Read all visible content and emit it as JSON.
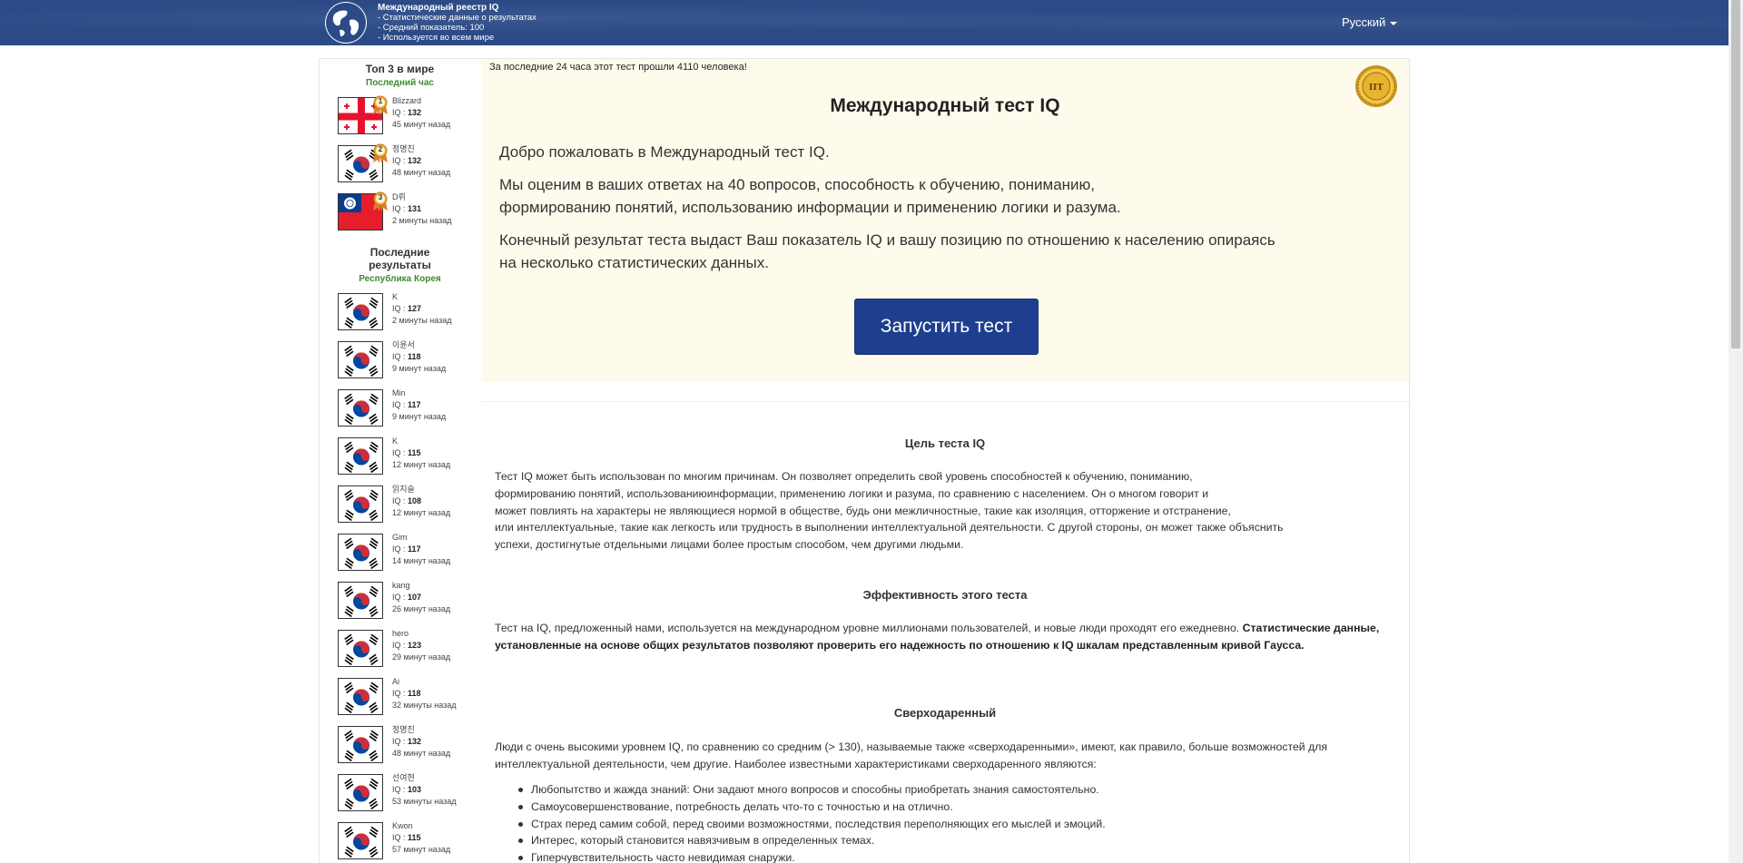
{
  "header": {
    "brand_title": "Международный реестр IQ",
    "brand_lines": [
      "- Статистические данные о результатах",
      "- Средний показатель: 100",
      "- Используется во всем мире"
    ],
    "language": "Русский"
  },
  "sidebar": {
    "top_title": "Топ 3 в мире",
    "top_sub": "Последний час",
    "top": [
      {
        "name": "Blizzard",
        "iq_label": "IQ : ",
        "iq": "132",
        "time": "45 минут назад",
        "flag": "georgia",
        "rank": "1"
      },
      {
        "name": "정명진",
        "iq_label": "IQ : ",
        "iq": "132",
        "time": "48 минут назад",
        "flag": "korea",
        "rank": "2"
      },
      {
        "name": "D뤼",
        "iq_label": "IQ : ",
        "iq": "131",
        "time": "2 минуты назад",
        "flag": "taiwan",
        "rank": "3"
      }
    ],
    "recent_title_1": "Последние",
    "recent_title_2": "результаты",
    "recent_sub": "Республика Корея",
    "recent": [
      {
        "name": "K",
        "iq_label": "IQ : ",
        "iq": "127",
        "time": "2 минуты назад",
        "flag": "korea"
      },
      {
        "name": "이윤서",
        "iq_label": "IQ : ",
        "iq": "118",
        "time": "9 минут назад",
        "flag": "korea"
      },
      {
        "name": "Min",
        "iq_label": "IQ : ",
        "iq": "117",
        "time": "9 минут назад",
        "flag": "korea"
      },
      {
        "name": "K",
        "iq_label": "IQ : ",
        "iq": "115",
        "time": "12 минут назад",
        "flag": "korea"
      },
      {
        "name": "읽지슬",
        "iq_label": "IQ : ",
        "iq": "108",
        "time": "12 минут назад",
        "flag": "korea"
      },
      {
        "name": "Gim",
        "iq_label": "IQ : ",
        "iq": "117",
        "time": "14 минут назад",
        "flag": "korea"
      },
      {
        "name": "kang",
        "iq_label": "IQ : ",
        "iq": "107",
        "time": "26 минут назад",
        "flag": "korea"
      },
      {
        "name": "hero",
        "iq_label": "IQ : ",
        "iq": "123",
        "time": "29 минут назад",
        "flag": "korea"
      },
      {
        "name": "Ai",
        "iq_label": "IQ : ",
        "iq": "118",
        "time": "32 минуты назад",
        "flag": "korea"
      },
      {
        "name": "정명진",
        "iq_label": "IQ : ",
        "iq": "132",
        "time": "48 минут назад",
        "flag": "korea"
      },
      {
        "name": "선여현",
        "iq_label": "IQ : ",
        "iq": "103",
        "time": "53 минуты назад",
        "flag": "korea"
      },
      {
        "name": "Kwon",
        "iq_label": "IQ : ",
        "iq": "115",
        "time": "57 минут назад",
        "flag": "korea"
      }
    ]
  },
  "hero": {
    "note": "За последние 24 часа этот тест прошли 4110 человека!",
    "seal_text": "IIT",
    "title": "Международный тест IQ",
    "p1": "Добро пожаловать в Международный тест IQ.",
    "p2a": "Мы оценим в ваших ответах на 40 вопросов, способность к обучению, пониманию,",
    "p2b": "формированию понятий, использованию информации и применению логики и разума.",
    "p3a": "Конечный результат теста выдаст Ваш показатель IQ и вашу позицию по отношению к населению опираясь",
    "p3b": "на несколько статистических данных.",
    "button": "Запустить тест"
  },
  "sections": {
    "s1_title": "Цель теста IQ",
    "s1_lines": [
      "Тест IQ может быть использован по многим причинам. Он позволяет определить свой уровень способностей к обучению, пониманию,",
      "формированию понятий, использованиюинформации, применению логики и разума, по сравнению с населением. Он о многом говорит и",
      "может повлиять на характеры не являющиеся нормой в обществе, будь они межличностные, такие как изоляция, отторжение и отстранение,",
      "или интеллектуальные, такие как легкость или трудность в выполнении интеллектуальной деятельности. С другой стороны, он может также объяснить",
      "успехи, достигнутые отдельными лицами более простым способом, чем другими людьми."
    ],
    "s2_title": "Эффективность этого теста",
    "s2_plain": "Тест на IQ, предложенный нами, используется на международном уровне миллионами пользователей, и новые люди проходят его ежедневно. ",
    "s2_bold": "Статистические данные, установленные на основе общих результатов позволяют проверить его надежность по отношению к IQ шкалам представленным кривой Гаусса.",
    "s3_title": "Сверходаренный",
    "s3_text": "Люди с очень высокими уровнем IQ, по сравнению со средним (> 130), называемые также «сверходаренными», имеют, как правило, больше возможностей для интеллектуальной деятельности, чем другие. Наиболее известными характеристиками сверходаренного являются:",
    "s3_bullets": [
      "Любопытство и жажда знаний: Они задают много вопросов и способны приобретать знания самостоятельно.",
      "Самоусовершенствование, потребность делать что-то с точностью и на отлично.",
      "Страх перед самим собой, перед своими возможностями, последствия переполняющих его мыслей и эмоций.",
      "Интерес, который становится навязчивым в определенных темах.",
      "Гиперчувствительность часто невидимая снаружи."
    ]
  },
  "colors": {
    "header_bg": "#2b4a86",
    "hero_bg": "#fffbec",
    "button_bg": "#1e3f8f",
    "sub_green": "#3c8a2e"
  }
}
